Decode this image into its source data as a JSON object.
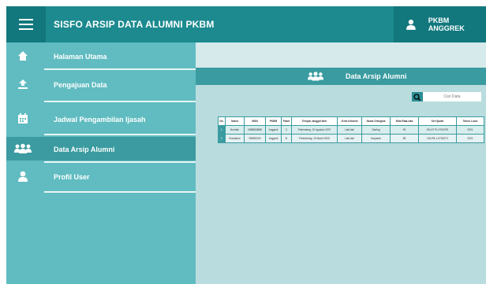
{
  "header": {
    "app_title": "SISFO ARSIP DATA ALUMNI PKBM",
    "user_name": "PKBM ANGGREK"
  },
  "sidebar": {
    "items": [
      {
        "label": "Halaman Utama",
        "icon": "home-icon"
      },
      {
        "label": "Pengajuan Data",
        "icon": "upload-icon"
      },
      {
        "label": "Jadwal Pengambilan Ijasah",
        "icon": "calendar-icon"
      },
      {
        "label": "Data Arsip Alumni",
        "icon": "users-icon",
        "active": true
      },
      {
        "label": "Profil User",
        "icon": "user-icon"
      }
    ]
  },
  "main": {
    "title": "Data Arsip Alumni",
    "search": {
      "placeholder": "Cari Data"
    },
    "table": {
      "columns": [
        "No.",
        "Nama",
        "NISN",
        "PKBM",
        "Paket",
        "Tempat, tanggal lahir",
        "Jenis Kelamin",
        "Nama Orangtua",
        "Nilai Rata-rata",
        "Seri Ijazah",
        "Tahun Lulus"
      ],
      "rows": [
        [
          "1.",
          "Nurdiah",
          "0088800888",
          "Anggrek",
          "C",
          "Palembang, 10 Agustus 2007",
          "Laki-laki",
          "Darling",
          "90",
          "DN-07 Pc 0702078",
          "2021"
        ],
        [
          "2.",
          "Rusdianto",
          "9989/0000",
          "Anggrek",
          "B",
          "Palembang, 15 Maret 2005",
          "Laki-laki",
          "Haryanto",
          "85",
          "DN-PB-1-0720073",
          "2021"
        ]
      ]
    }
  },
  "colors": {
    "header": "#1c8a8f",
    "sidebar": "#60bcc1",
    "accent": "#3a9ba0",
    "main_bg": "#b9dcde"
  }
}
